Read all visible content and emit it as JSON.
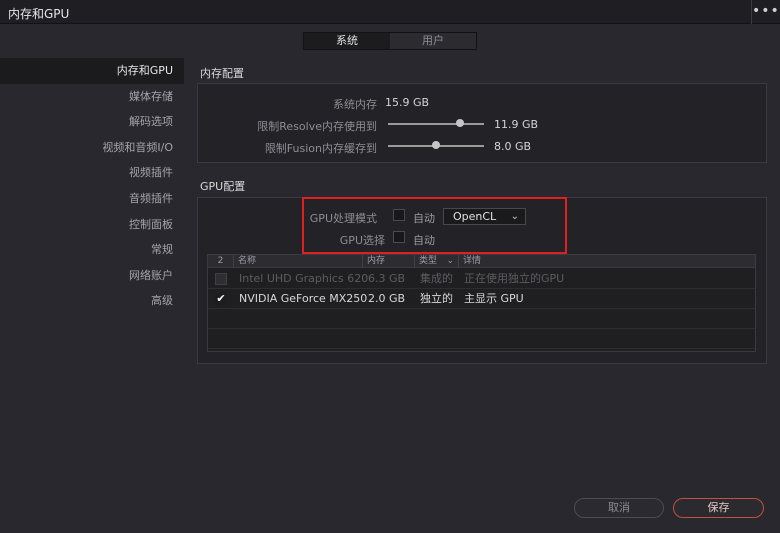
{
  "window": {
    "title": "内存和GPU",
    "menu_icon": "more-dots-icon"
  },
  "tabs": [
    {
      "label": "系统",
      "active": true
    },
    {
      "label": "用户",
      "active": false
    }
  ],
  "sidebar": {
    "items": [
      {
        "label": "内存和GPU",
        "active": true
      },
      {
        "label": "媒体存储"
      },
      {
        "label": "解码选项"
      },
      {
        "label": "视频和音频I/O"
      },
      {
        "label": "视频插件"
      },
      {
        "label": "音频插件"
      },
      {
        "label": "控制面板"
      },
      {
        "label": "常规"
      },
      {
        "label": "网络账户"
      },
      {
        "label": "高级"
      }
    ]
  },
  "memory": {
    "title": "内存配置",
    "system_memory_label": "系统内存",
    "system_memory_value": "15.9 GB",
    "resolve_limit_label": "限制Resolve内存使用到",
    "resolve_limit_value": "11.9 GB",
    "resolve_limit_fraction": 0.75,
    "fusion_limit_label": "限制Fusion内存缓存到",
    "fusion_limit_value": "8.0 GB",
    "fusion_limit_fraction": 0.5
  },
  "gpu": {
    "title": "GPU配置",
    "mode_label": "GPU处理模式",
    "mode_auto_label": "自动",
    "mode_auto_checked": false,
    "mode_value": "OpenCL",
    "select_label": "GPU选择",
    "select_auto_label": "自动",
    "select_auto_checked": false,
    "table": {
      "headers": {
        "count": "2",
        "name": "名称",
        "memory": "内存",
        "type": "类型",
        "details": "详情"
      },
      "rows": [
        {
          "checked": false,
          "enabled": false,
          "name": "Intel UHD Graphics 620",
          "memory": "6.3 GB",
          "type": "集成的",
          "details": "正在使用独立的GPU"
        },
        {
          "checked": true,
          "enabled": true,
          "name": "NVIDIA GeForce MX250",
          "memory": "2.0 GB",
          "type": "独立的",
          "details": "主显示 GPU"
        }
      ]
    }
  },
  "buttons": {
    "cancel": "取消",
    "save": "保存"
  },
  "colors": {
    "highlight": "#e02020",
    "save_accent": "#c4503f"
  }
}
